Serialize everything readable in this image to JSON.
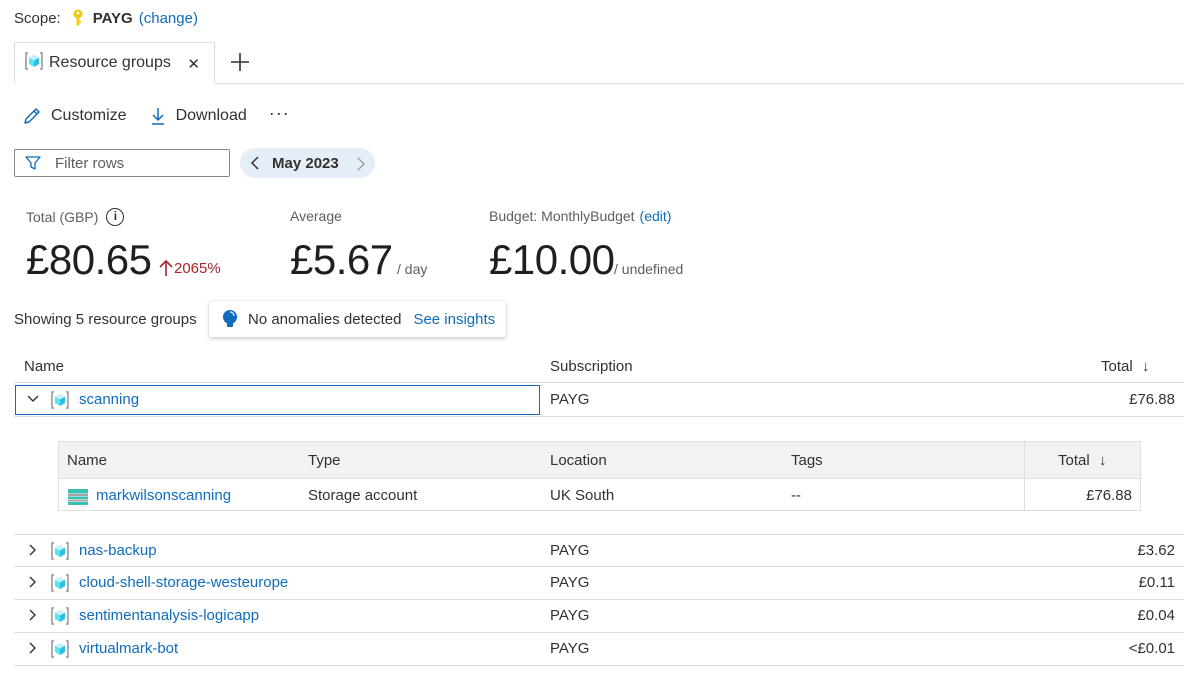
{
  "scope": {
    "label": "Scope:",
    "value": "PAYG",
    "change_link": "(change)"
  },
  "tabs": [
    {
      "label": "Resource groups",
      "close": "✕"
    }
  ],
  "toolbar": {
    "customize": "Customize",
    "download": "Download",
    "more": "···"
  },
  "filter": {
    "placeholder": "Filter rows"
  },
  "period": {
    "label": "May 2023"
  },
  "metrics": {
    "total": {
      "label": "Total (GBP)",
      "info": "i",
      "value": "£80.65",
      "change": "2065%"
    },
    "average": {
      "label": "Average",
      "value": "£5.67",
      "unit": "/ day"
    },
    "budget": {
      "label": "Budget: MonthlyBudget",
      "edit": "(edit)",
      "value": "£10.00",
      "unit": "/ undefined"
    }
  },
  "summary": {
    "showing": "Showing 5 resource groups",
    "anomalies": "No anomalies detected",
    "insights": "See insights"
  },
  "grid": {
    "columns": {
      "name": "Name",
      "subscription": "Subscription",
      "total": "Total",
      "sort": "↓"
    },
    "rows": [
      {
        "name": "scanning",
        "subscription": "PAYG",
        "total": "£76.88",
        "expanded": true
      },
      {
        "name": "nas-backup",
        "subscription": "PAYG",
        "total": "£3.62"
      },
      {
        "name": "cloud-shell-storage-westeurope",
        "subscription": "PAYG",
        "total": "£0.11"
      },
      {
        "name": "sentimentanalysis-logicapp",
        "subscription": "PAYG",
        "total": "£0.04"
      },
      {
        "name": "virtualmark-bot",
        "subscription": "PAYG",
        "total": "<£0.01"
      }
    ]
  },
  "nested": {
    "columns": {
      "name": "Name",
      "type": "Type",
      "location": "Location",
      "tags": "Tags",
      "total": "Total",
      "sort": "↓"
    },
    "rows": [
      {
        "name": "markwilsonscanning",
        "type": "Storage account",
        "location": "UK South",
        "tags": "--",
        "total": "£76.88"
      }
    ]
  },
  "colors": {
    "accent": "#0f6cbd",
    "negative": "#a4262c",
    "period_bg": "#e5eef8",
    "key": "#f2c811"
  },
  "icons": [
    "key-icon",
    "resource-group-icon",
    "close-icon",
    "plus-icon",
    "pencil-icon",
    "download-icon",
    "filter-icon",
    "chevron-left-icon",
    "chevron-right-icon",
    "info-icon",
    "arrow-up-icon",
    "lightbulb-icon",
    "chevron-down-icon",
    "storage-account-icon",
    "sort-down-icon"
  ]
}
